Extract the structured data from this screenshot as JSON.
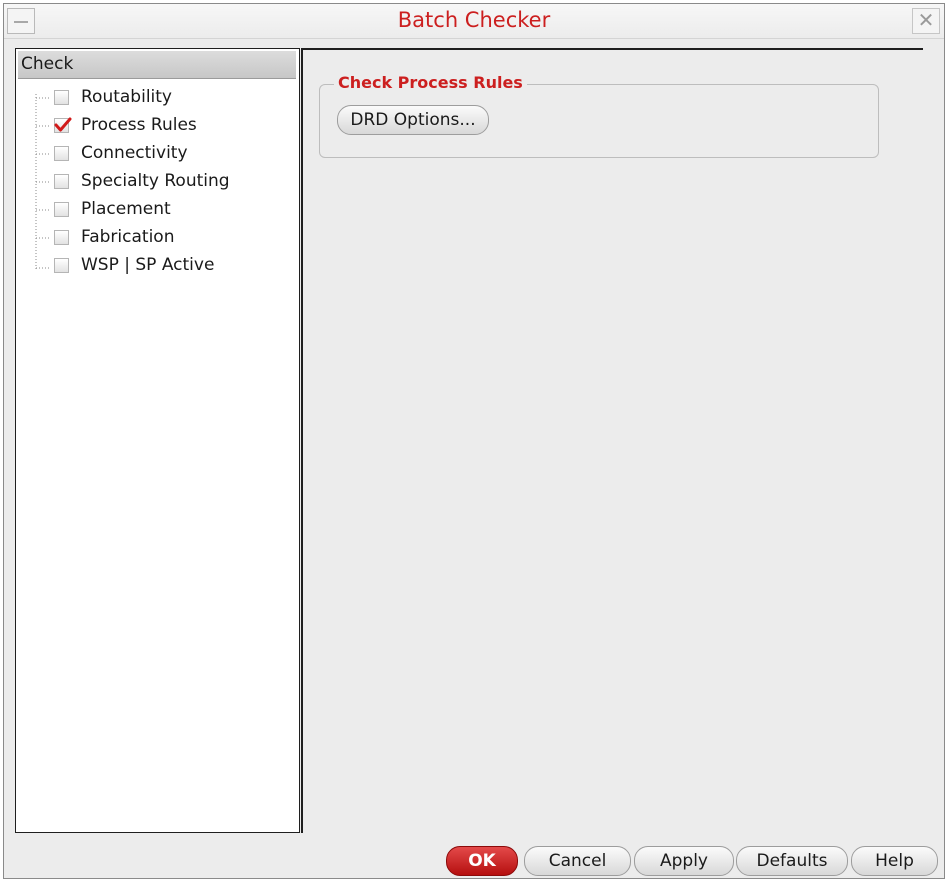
{
  "window": {
    "title": "Batch Checker"
  },
  "tree": {
    "header": "Check",
    "items": [
      {
        "label": "Routability",
        "checked": false
      },
      {
        "label": "Process Rules",
        "checked": true
      },
      {
        "label": "Connectivity",
        "checked": false
      },
      {
        "label": "Specialty Routing",
        "checked": false
      },
      {
        "label": "Placement",
        "checked": false
      },
      {
        "label": "Fabrication",
        "checked": false
      },
      {
        "label": "WSP | SP Active",
        "checked": false
      }
    ]
  },
  "panel": {
    "group_title": "Check Process Rules",
    "drd_button": "DRD Options..."
  },
  "footer": {
    "ok": "OK",
    "cancel": "Cancel",
    "apply": "Apply",
    "defaults": "Defaults",
    "help": "Help"
  },
  "colors": {
    "title_red": "#cc1f1f",
    "ok_red": "#c41515",
    "check_red": "#d11a1a"
  }
}
